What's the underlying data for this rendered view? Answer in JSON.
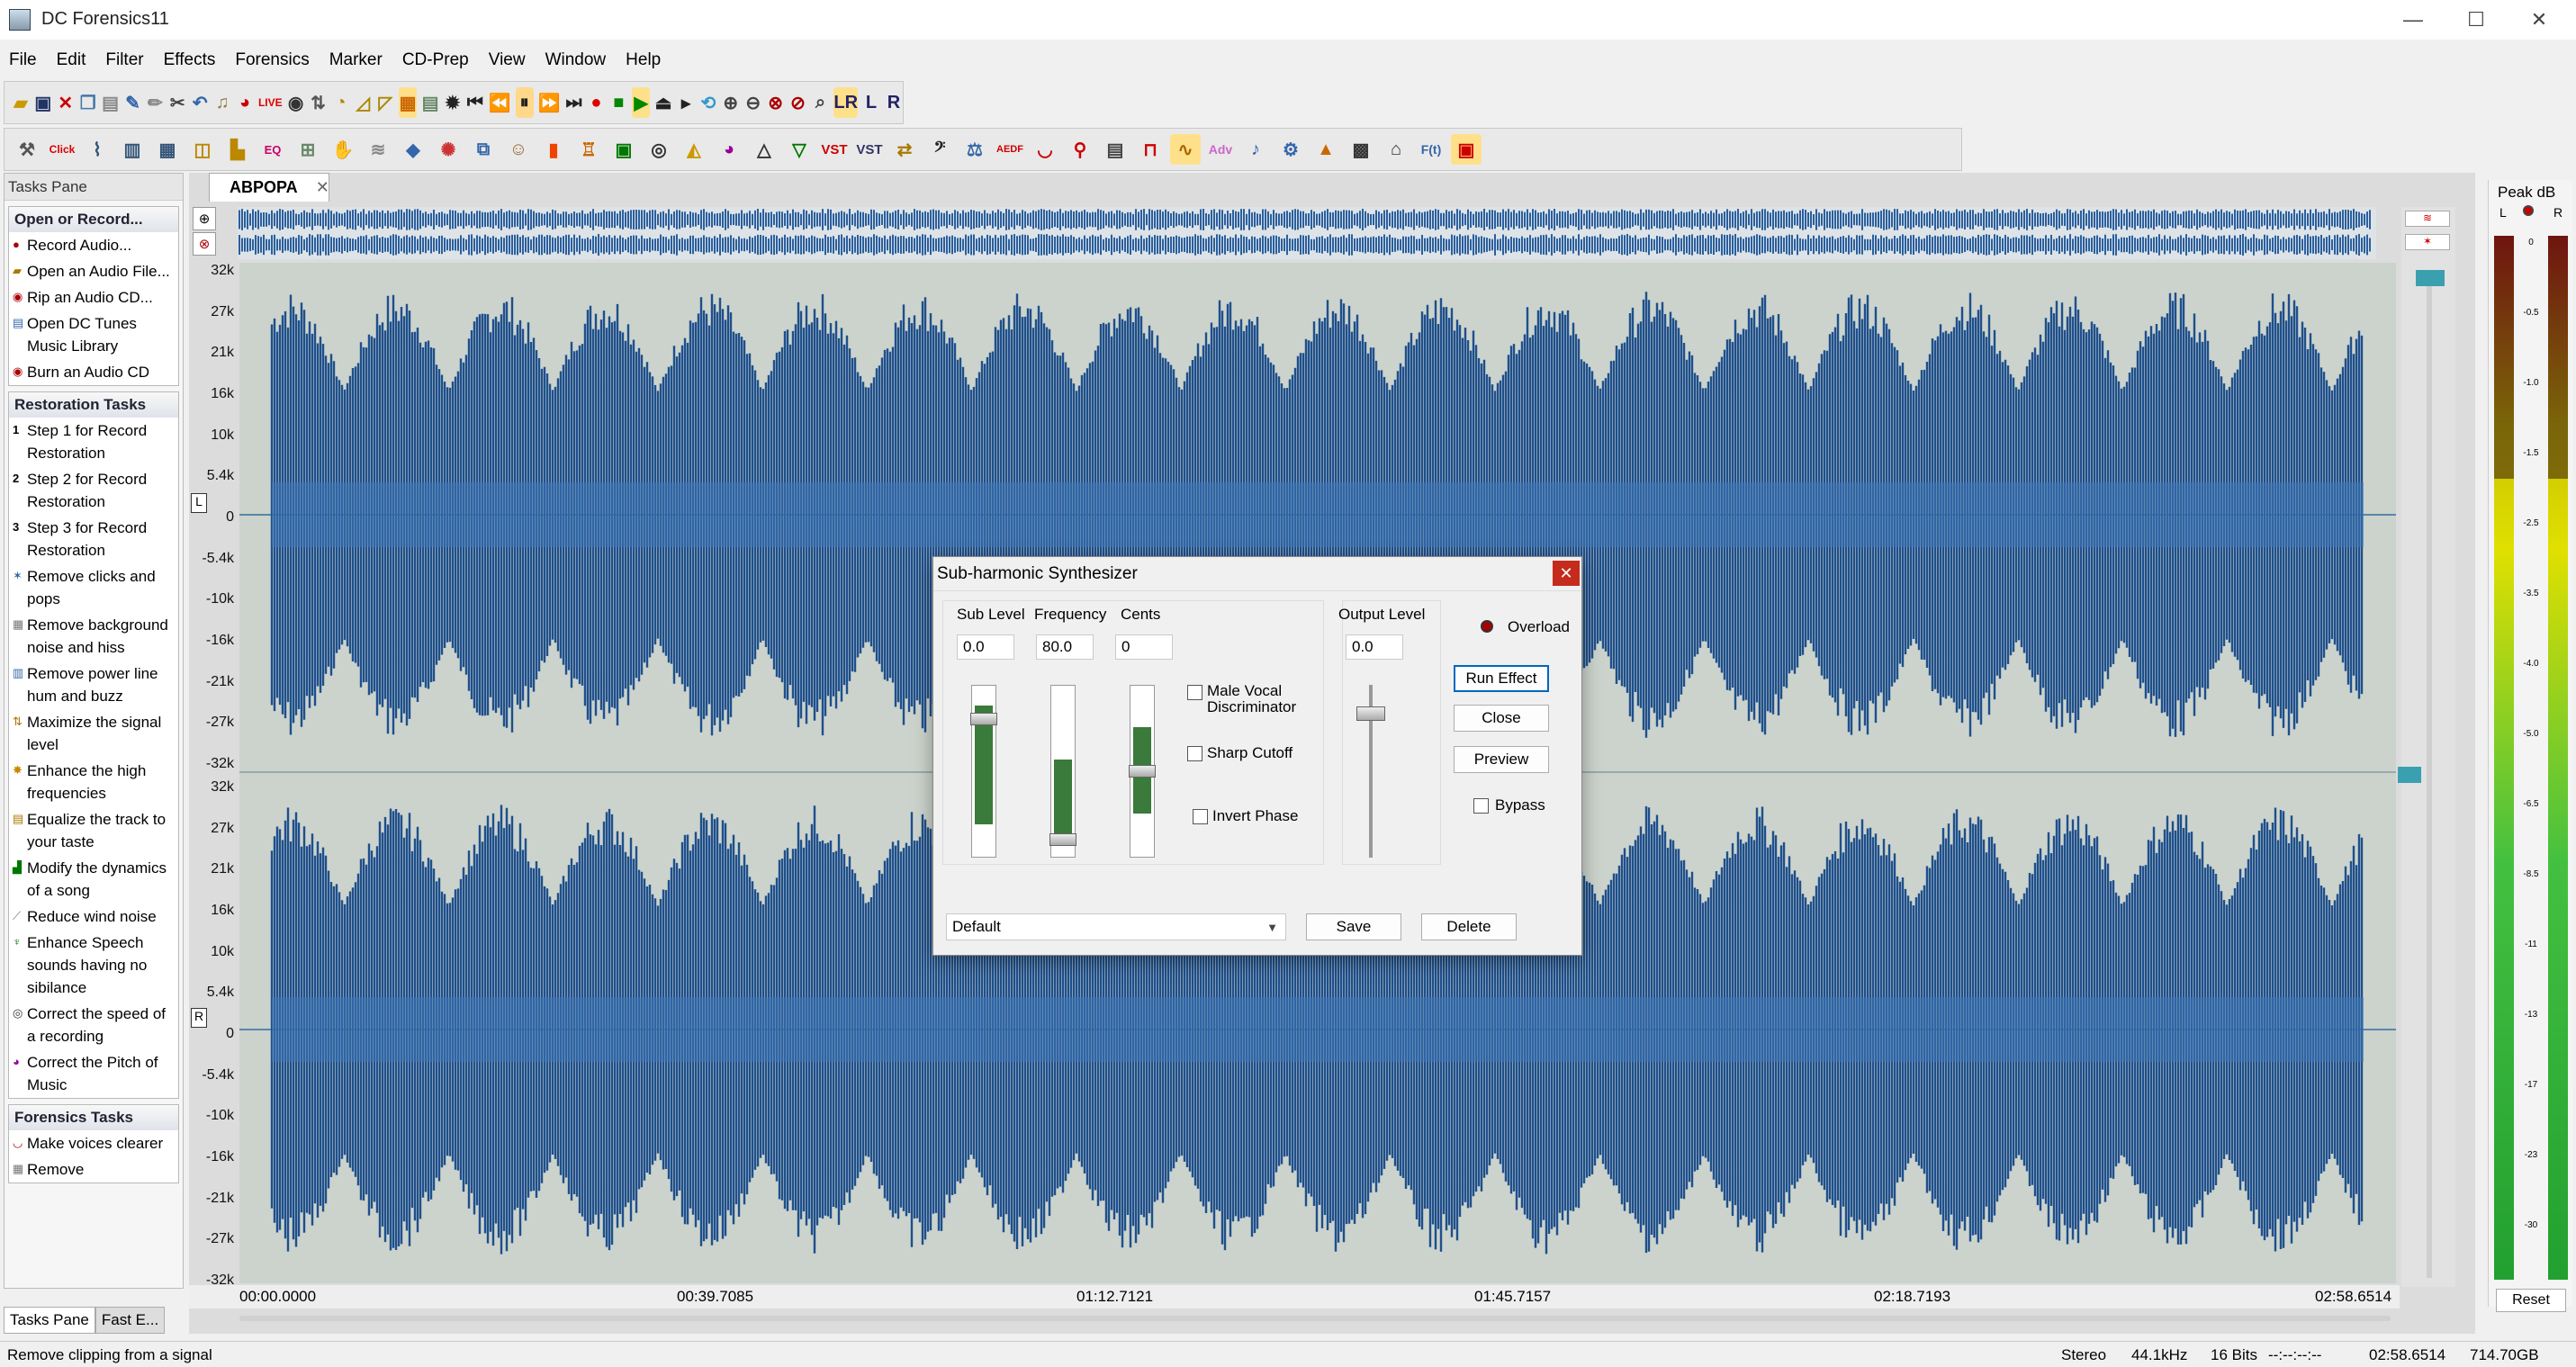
{
  "window": {
    "title": "DC Forensics11"
  },
  "menu": [
    "File",
    "Edit",
    "Filter",
    "Effects",
    "Forensics",
    "Marker",
    "CD-Prep",
    "View",
    "Window",
    "Help"
  ],
  "toolbar": {
    "row2_labels": {
      "vst": "VST",
      "vst2": "VST",
      "adv": "Adv",
      "fx": "F(t)"
    }
  },
  "tasks_pane": {
    "title": "Tasks Pane",
    "sections": [
      {
        "title": "Open or Record...",
        "items": [
          "Record Audio...",
          "Open an Audio File...",
          "Rip an Audio CD...",
          "Open DC Tunes Music Library",
          "Burn an Audio CD"
        ]
      },
      {
        "title": "Restoration Tasks",
        "items": [
          "Step 1 for Record Restoration",
          "Step 2 for Record Restoration",
          "Step 3 for Record Restoration",
          "Remove clicks and pops",
          "Remove background noise and hiss",
          "Remove power line hum and buzz",
          "Maximize the signal level",
          "Enhance the high frequencies",
          "Equalize the track to your taste",
          "Modify the dynamics of a song",
          "Reduce wind noise",
          "Enhance Speech sounds having no sibilance",
          "Correct the speed of a recording",
          "Correct the Pitch of Music"
        ]
      },
      {
        "title": "Forensics Tasks",
        "items": [
          "Make voices clearer",
          "Remove"
        ]
      }
    ],
    "bottom_tabs": [
      "Tasks Pane",
      "Fast E..."
    ]
  },
  "document": {
    "tab": "ABPOPA"
  },
  "waveform": {
    "channel_tags": [
      "L",
      "R"
    ],
    "y_labels": [
      "32k",
      "27k",
      "21k",
      "16k",
      "10k",
      "5.4k",
      "0",
      "-5.4k",
      "-10k",
      "-16k",
      "-21k",
      "-27k",
      "-32k"
    ],
    "time_labels": [
      "00:00.0000",
      "00:39.7085",
      "01:12.7121",
      "01:45.7157",
      "02:18.7193",
      "02:58.6514"
    ]
  },
  "meter": {
    "title": "Peak dB",
    "channels": [
      "L",
      "R"
    ],
    "ticks": [
      "0",
      "-0.5",
      "-1.0",
      "-1.5",
      "-2.5",
      "-3.5",
      "-4.0",
      "-5.0",
      "-6.5",
      "-8.5",
      "-11",
      "-13",
      "-17",
      "-23",
      "-30"
    ],
    "reset": "Reset"
  },
  "status": {
    "message": "Remove clipping from a signal",
    "channels": "Stereo",
    "rate": "44.1kHz",
    "bits": "16 Bits",
    "position": "--:--:--:--",
    "length": "02:58.6514",
    "disk": "714.70GB"
  },
  "dialog": {
    "title": "Sub-harmonic Synthesizer",
    "sub_level": {
      "label": "Sub Level",
      "value": "0.0"
    },
    "frequency": {
      "label": "Frequency",
      "value": "80.0"
    },
    "cents": {
      "label": "Cents",
      "value": "0"
    },
    "output_level": {
      "label": "Output Level",
      "value": "0.0"
    },
    "checkboxes": {
      "male_vocal": "Male Vocal Discriminator",
      "sharp_cutoff": "Sharp Cutoff",
      "invert_phase": "Invert Phase",
      "bypass": "Bypass"
    },
    "overload": "Overload",
    "buttons": {
      "run": "Run Effect",
      "close": "Close",
      "preview": "Preview",
      "save": "Save",
      "delete": "Delete"
    },
    "preset": "Default"
  }
}
